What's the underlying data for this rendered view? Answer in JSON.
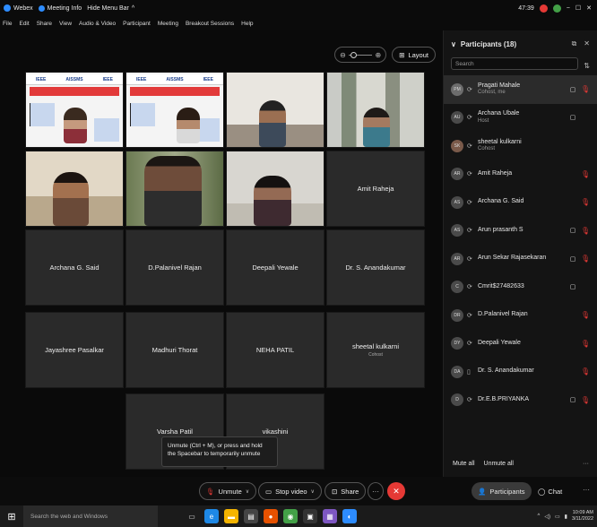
{
  "titlebar": {
    "app": "Webex",
    "meeting_info": "Meeting Info",
    "hide_menu": "Hide Menu Bar",
    "time": "47:39",
    "window_ctrls": [
      "−",
      "☐",
      "✕"
    ]
  },
  "menu": [
    "File",
    "Edit",
    "Share",
    "View",
    "Audio & Video",
    "Participant",
    "Meeting",
    "Breakout Sessions",
    "Help"
  ],
  "stage": {
    "layout_label": "Layout",
    "poster_brand": "AISSMS",
    "poster_ieee": "IEEE",
    "tiles": [
      {
        "name": "Amit Raheja",
        "sub": ""
      },
      {
        "name": "Archana G. Said",
        "sub": ""
      },
      {
        "name": "D.Palanivel Rajan",
        "sub": ""
      },
      {
        "name": "Deepali Yewale",
        "sub": ""
      },
      {
        "name": "Dr. S. Anandakumar",
        "sub": ""
      },
      {
        "name": "Jayashree Pasalkar",
        "sub": ""
      },
      {
        "name": "Madhuri Thorat",
        "sub": ""
      },
      {
        "name": "NEHA PATIL",
        "sub": ""
      },
      {
        "name": "sheetal kulkarni",
        "sub": "Cohost"
      },
      {
        "name": "Varsha Patil",
        "sub": ""
      },
      {
        "name": "vikashini",
        "sub": ""
      }
    ],
    "tooltip": "Unmute (Ctrl + M), or press and hold the Spacebar to temporarily unmute"
  },
  "participants": {
    "title": "Participants (18)",
    "search_placeholder": "Search",
    "list": [
      {
        "initials": "PM",
        "name": "Pragati Mahale",
        "role": "Cohost, me"
      },
      {
        "initials": "AU",
        "name": "Archana Ubale",
        "role": "Host"
      },
      {
        "initials": "SK",
        "name": "sheetal kulkarni",
        "role": "Cohost"
      },
      {
        "initials": "AR",
        "name": "Amit Raheja",
        "role": ""
      },
      {
        "initials": "AS",
        "name": "Archana G. Said",
        "role": ""
      },
      {
        "initials": "AS",
        "name": "Arun prasanth S",
        "role": ""
      },
      {
        "initials": "AR",
        "name": "Arun Sekar Rajasekaran",
        "role": ""
      },
      {
        "initials": "C",
        "name": "Cmrit$27482633",
        "role": ""
      },
      {
        "initials": "DR",
        "name": "D.Palanivel Rajan",
        "role": ""
      },
      {
        "initials": "DY",
        "name": "Deepali Yewale",
        "role": ""
      },
      {
        "initials": "DA",
        "name": "Dr. S. Anandakumar",
        "role": ""
      },
      {
        "initials": "D",
        "name": "Dr.E.B.PRIYANKA",
        "role": ""
      }
    ],
    "mute_all": "Mute all",
    "unmute_all": "Unmute all"
  },
  "controls": {
    "unmute": "Unmute",
    "stop_video": "Stop video",
    "share": "Share",
    "participants": "Participants",
    "chat": "Chat"
  },
  "taskbar": {
    "search": "Search the web and Windows",
    "time": "10:09 AM",
    "date": "3/11/2022"
  }
}
